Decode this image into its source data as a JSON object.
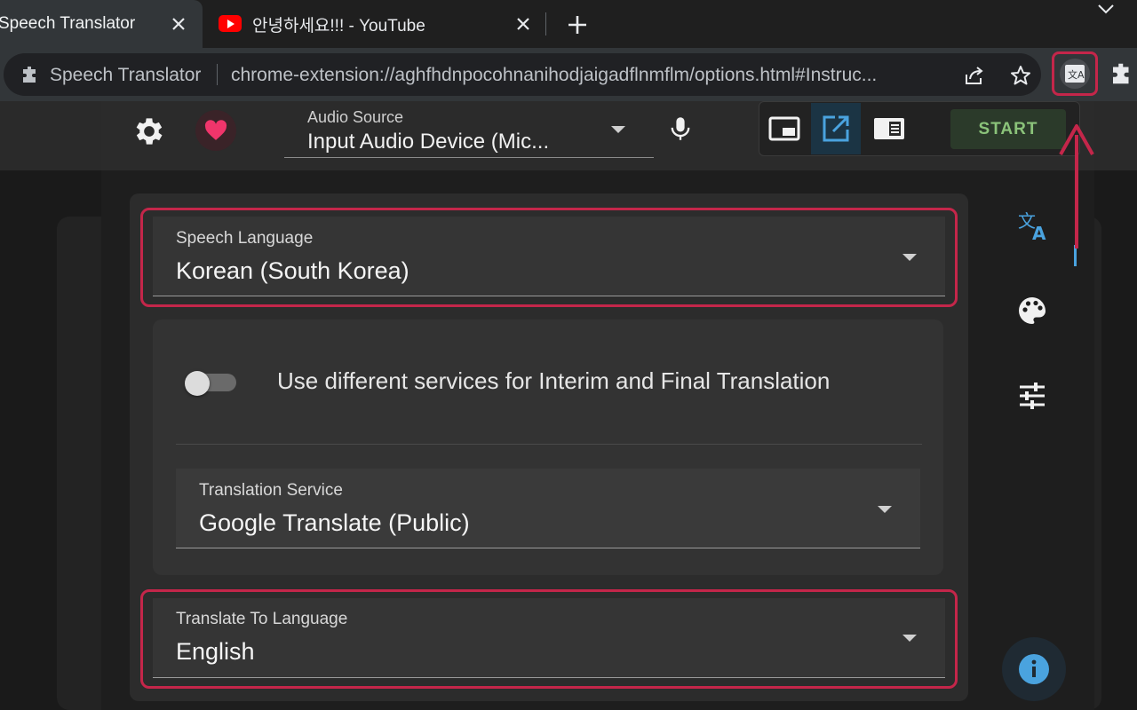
{
  "tabs": [
    {
      "title": "Speech Translator",
      "active": true
    },
    {
      "title": "안녕하세요!!! - YouTube",
      "active": false
    }
  ],
  "omnibox": {
    "site": "Speech Translator",
    "url": "chrome-extension://aghfhdnpocohnanihodjaigadflnmflm/options.html#Instruc..."
  },
  "header": {
    "audio_source_label": "Audio Source",
    "audio_source_value": "Input Audio Device (Mic...",
    "start_label": "START"
  },
  "settings": {
    "speech_language_label": "Speech Language",
    "speech_language_value": "Korean (South Korea)",
    "toggle_label": "Use different services for Interim and Final Translation",
    "toggle_on": false,
    "translation_service_label": "Translation Service",
    "translation_service_value": "Google Translate (Public)",
    "translate_to_label": "Translate To Language",
    "translate_to_value": "English"
  },
  "colors": {
    "highlight": "#c4264a",
    "accent_blue": "#4aa3df",
    "start_green": "#8bc37a",
    "heart": "#f0356b"
  }
}
